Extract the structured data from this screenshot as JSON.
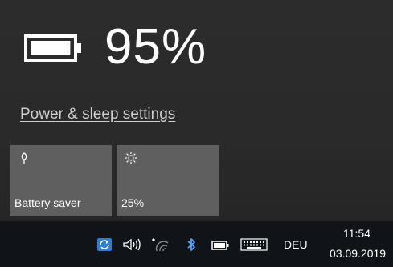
{
  "flyout": {
    "battery_percent_text": "95%",
    "battery_level": 0.95,
    "power_link": "Power & sleep settings",
    "tiles": [
      {
        "label": "Battery saver",
        "icon": "battery-saver-icon"
      },
      {
        "label": "25%",
        "icon": "brightness-icon"
      }
    ]
  },
  "taskbar": {
    "tray_icons": [
      "windows-update-icon",
      "volume-icon",
      "wifi-icon",
      "bluetooth-icon",
      "battery-icon",
      "touch-keyboard-icon"
    ],
    "language": "DEU",
    "time": "11:54",
    "date": "03.09.2019"
  },
  "colors": {
    "flyout_bg": "#2b2b2b",
    "tile_bg": "#5f5f5f",
    "taskbar_bg": "#101418",
    "text": "#ffffff",
    "bluetooth": "#4aa3ff"
  }
}
